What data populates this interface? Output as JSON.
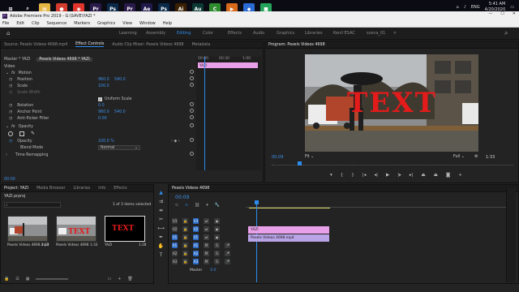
{
  "taskbar": {
    "clock_time": "5:41 AM",
    "clock_date": "4/20/2020",
    "lang": "ENG",
    "apps": [
      {
        "name": "windows-start",
        "color": "#0b0b14",
        "glyph": "⊞"
      },
      {
        "name": "search",
        "color": "#0b0b14",
        "glyph": "⌕"
      },
      {
        "name": "file-explorer",
        "color": "#e4b645",
        "glyph": "▤"
      },
      {
        "name": "chrome",
        "color": "#d23b2e",
        "glyph": "●"
      },
      {
        "name": "app-red-circle",
        "color": "#e0342c",
        "glyph": "◉"
      },
      {
        "name": "premiere-pro",
        "color": "#2a1a4a",
        "glyph": "Pr"
      },
      {
        "name": "photoshop",
        "color": "#0b2a4a",
        "glyph": "Ps"
      },
      {
        "name": "premiere-pro-2",
        "color": "#2a1a4a",
        "glyph": "Pr"
      },
      {
        "name": "after-effects",
        "color": "#1f1a4a",
        "glyph": "Ae"
      },
      {
        "name": "photoshop-2",
        "color": "#0b2a4a",
        "glyph": "Ps"
      },
      {
        "name": "illustrator",
        "color": "#3a1f00",
        "glyph": "Ai"
      },
      {
        "name": "audition",
        "color": "#0a3a33",
        "glyph": "Au"
      },
      {
        "name": "camtasia",
        "color": "#2e8b2e",
        "glyph": "C"
      },
      {
        "name": "media-player",
        "color": "#d86a1c",
        "glyph": "▶"
      },
      {
        "name": "app-blue",
        "color": "#2a6bd4",
        "glyph": "◆"
      },
      {
        "name": "app-green",
        "color": "#24a35a",
        "glyph": "■"
      }
    ]
  },
  "window": {
    "title": "Adobe Premiere Pro 2019 - G:\\SAVE\\YAZI *",
    "min": "—",
    "max": "☐",
    "close": "✕"
  },
  "menu": [
    "File",
    "Edit",
    "Clip",
    "Sequence",
    "Markers",
    "Graphics",
    "View",
    "Window",
    "Help"
  ],
  "workspaces": [
    {
      "label": "Learning",
      "active": false
    },
    {
      "label": "Assembly",
      "active": false
    },
    {
      "label": "Editing",
      "active": true
    },
    {
      "label": "Color",
      "active": false
    },
    {
      "label": "Effects",
      "active": false
    },
    {
      "label": "Audio",
      "active": false
    },
    {
      "label": "Graphics",
      "active": false
    },
    {
      "label": "Libraries",
      "active": false
    },
    {
      "label": "Kenil ESAC",
      "active": false
    },
    {
      "label": "sosna_01",
      "active": false
    }
  ],
  "effect_panel": {
    "tabs": [
      {
        "label": "Source: Pexels Videos 4698.mp4",
        "active": false
      },
      {
        "label": "Effect Controls",
        "active": true
      },
      {
        "label": "Audio Clip Mixer: Pexels Videos 4698",
        "active": false
      },
      {
        "label": "Metadata",
        "active": false
      }
    ],
    "master": "Master * YAZI",
    "clip": "Pexels Videos 4698 * YAZI",
    "section_video": "Video",
    "motion": "Motion",
    "position_label": "Position",
    "position_x": "960.0",
    "position_y": "540.0",
    "scale_label": "Scale",
    "scale_value": "100.0",
    "scale_width_label": "Scale Width",
    "uniform_scale_label": "Uniform Scale",
    "rotation_label": "Rotation",
    "rotation_value": "0.0",
    "anchor_label": "Anchor Point",
    "anchor_x": "960.0",
    "anchor_y": "540.0",
    "flicker_label": "Anti-flicker Filter",
    "flicker_value": "0.00",
    "opacity": "Opacity",
    "opacity_label": "Opacity",
    "opacity_value": "100.0 %",
    "blend_label": "Blend Mode",
    "blend_value": "Normal",
    "time_remap": "Time Remapping",
    "timecode": "00:00",
    "ruler_start": "00:00",
    "ruler_mid": "00:30",
    "ruler_end": "1:00",
    "mini_clip": "YAZI"
  },
  "program": {
    "title": "Program: Pexels Videos 4698",
    "overlay_text": "TEXT",
    "timecode": "00:09",
    "fit": "Fit",
    "quality": "Full",
    "duration": "1:33"
  },
  "project": {
    "tabs": [
      {
        "label": "Project: YAZI",
        "active": true
      },
      {
        "label": "Media Browser",
        "active": false
      },
      {
        "label": "Libraries",
        "active": false
      },
      {
        "label": "Info",
        "active": false
      },
      {
        "label": "Effects",
        "active": false
      }
    ],
    "file": "YAZI.prproj",
    "selected_info": "1 of 3 items selected",
    "items": [
      {
        "name": "Pexels Videos 4698.mp4",
        "duration": "1:33",
        "type": "street"
      },
      {
        "name": "Pexels Videos 4698",
        "duration": "1:33",
        "type": "street-text"
      },
      {
        "name": "YAZI",
        "duration": "1:28",
        "type": "text"
      }
    ]
  },
  "timeline": {
    "tab": "Pexels Videos 4698",
    "timecode": "00:09",
    "master_label": "Master",
    "master_value": "0.0",
    "tracks": [
      {
        "name": "V3",
        "type": "video"
      },
      {
        "name": "V2",
        "type": "video"
      },
      {
        "name": "V1",
        "type": "video"
      },
      {
        "name": "A1",
        "type": "audio"
      },
      {
        "name": "A2",
        "type": "audio"
      },
      {
        "name": "A3",
        "type": "audio"
      }
    ],
    "clips": [
      {
        "label": "YAZI",
        "track": "V2",
        "color": "#e8a0e8"
      },
      {
        "label": "Pexels Videos 4698.mp4",
        "track": "V1",
        "color": "#b9a4e8"
      }
    ]
  }
}
